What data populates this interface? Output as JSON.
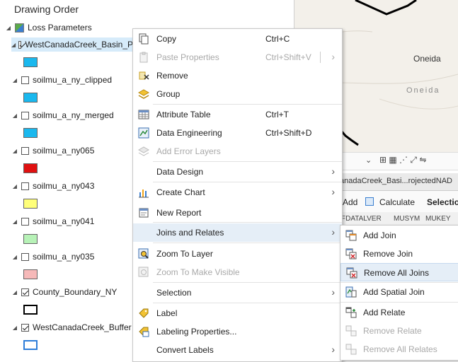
{
  "toc": {
    "title": "Drawing Order",
    "group": "Loss Parameters",
    "layers": [
      {
        "name": "WestCanadaCreek_Basin_P",
        "checked": true,
        "swatch": "#1ab8ee",
        "outline": false
      },
      {
        "name": "soilmu_a_ny_clipped",
        "checked": false,
        "swatch": "#1ab8ee",
        "outline": false
      },
      {
        "name": "soilmu_a_ny_merged",
        "checked": false,
        "swatch": "#1ab8ee",
        "outline": false
      },
      {
        "name": "soilmu_a_ny065",
        "checked": false,
        "swatch": "#e01010",
        "outline": false
      },
      {
        "name": "soilmu_a_ny043",
        "checked": false,
        "swatch": "#ffff7a",
        "outline": false
      },
      {
        "name": "soilmu_a_ny041",
        "checked": false,
        "swatch": "#b7f2b7",
        "outline": false
      },
      {
        "name": "soilmu_a_ny035",
        "checked": false,
        "swatch": "#f6b9b9",
        "outline": false
      },
      {
        "name": "County_Boundary_NY",
        "checked": true,
        "swatch": "#000000",
        "outline": true
      },
      {
        "name": "WestCanadaCreek_Buffer",
        "checked": true,
        "swatch": "#2e7dd9",
        "outline": true
      }
    ]
  },
  "map": {
    "labels": [
      "Oneida",
      "Oneida"
    ]
  },
  "attr_table": {
    "tab": "anadaCreek_Basi...rojectedNAD",
    "add": "Add",
    "calculate": "Calculate",
    "selection": "Selectio",
    "columns": [
      "FDATALVER",
      "MUSYM",
      "MUKEY"
    ]
  },
  "context_menu": {
    "items": [
      {
        "label": "Copy",
        "shortcut": "Ctrl+C",
        "icon": "copy-icon",
        "disabled": false,
        "arrow": false
      },
      {
        "label": "Paste Properties",
        "shortcut": "Ctrl+Shift+V",
        "icon": "paste-icon",
        "disabled": true,
        "arrow": true
      },
      {
        "label": "Remove",
        "shortcut": "",
        "icon": "remove-icon",
        "disabled": false,
        "arrow": false
      },
      {
        "label": "Group",
        "shortcut": "",
        "icon": "group-icon",
        "disabled": false,
        "arrow": false
      },
      {
        "label": "Attribute Table",
        "shortcut": "Ctrl+T",
        "icon": "table-icon",
        "disabled": false,
        "arrow": false
      },
      {
        "label": "Data Engineering",
        "shortcut": "Ctrl+Shift+D",
        "icon": "data-engineering-icon",
        "disabled": false,
        "arrow": false
      },
      {
        "label": "Add Error Layers",
        "shortcut": "",
        "icon": "error-layers-icon",
        "disabled": true,
        "arrow": false
      },
      {
        "label": "Data Design",
        "shortcut": "",
        "icon": "",
        "disabled": false,
        "arrow": true
      },
      {
        "label": "Create Chart",
        "shortcut": "",
        "icon": "chart-icon",
        "disabled": false,
        "arrow": true
      },
      {
        "label": "New Report",
        "shortcut": "",
        "icon": "report-icon",
        "disabled": false,
        "arrow": false
      },
      {
        "label": "Joins and Relates",
        "shortcut": "",
        "icon": "",
        "disabled": false,
        "arrow": true
      },
      {
        "label": "Zoom To Layer",
        "shortcut": "",
        "icon": "zoom-layer-icon",
        "disabled": false,
        "arrow": false
      },
      {
        "label": "Zoom To Make Visible",
        "shortcut": "",
        "icon": "zoom-visible-icon",
        "disabled": true,
        "arrow": false
      },
      {
        "label": "Selection",
        "shortcut": "",
        "icon": "",
        "disabled": false,
        "arrow": true
      },
      {
        "label": "Label",
        "shortcut": "",
        "icon": "label-icon",
        "disabled": false,
        "arrow": false
      },
      {
        "label": "Labeling Properties...",
        "shortcut": "",
        "icon": "labeling-properties-icon",
        "disabled": false,
        "arrow": false
      },
      {
        "label": "Convert Labels",
        "shortcut": "",
        "icon": "",
        "disabled": false,
        "arrow": true
      }
    ]
  },
  "submenu": {
    "items": [
      {
        "label": "Add Join",
        "icon": "add-join-icon",
        "disabled": false
      },
      {
        "label": "Remove Join",
        "icon": "remove-join-icon",
        "disabled": false
      },
      {
        "label": "Remove All Joins",
        "icon": "remove-all-joins-icon",
        "disabled": false
      },
      {
        "label": "Add Spatial Join",
        "icon": "spatial-join-icon",
        "disabled": false
      },
      {
        "label": "Add Relate",
        "icon": "add-relate-icon",
        "disabled": false
      },
      {
        "label": "Remove Relate",
        "icon": "remove-relate-icon",
        "disabled": true
      },
      {
        "label": "Remove All Relates",
        "icon": "remove-all-relates-icon",
        "disabled": true
      }
    ]
  }
}
